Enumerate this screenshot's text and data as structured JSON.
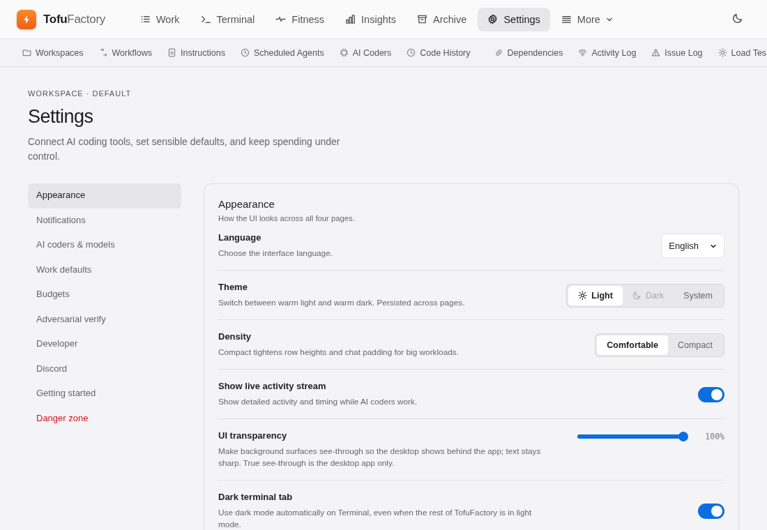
{
  "brand": {
    "name": "**Tofu**Factory"
  },
  "nav": [
    {
      "label": "Work",
      "selected": false
    },
    {
      "label": "Terminal",
      "selected": false
    },
    {
      "label": "Fitness",
      "selected": false
    },
    {
      "label": "Insights",
      "selected": false
    },
    {
      "label": "Archive",
      "selected": false
    },
    {
      "label": "Settings",
      "selected": true
    },
    {
      "label": "More",
      "selected": false
    }
  ],
  "subnav": [
    {
      "label": "Workspaces"
    },
    {
      "label": "Workflows"
    },
    {
      "label": "Instructions"
    },
    {
      "label": "Scheduled Agents"
    },
    {
      "label": "AI Coders"
    },
    {
      "label": "Code History"
    },
    {
      "label": "Dependencies"
    },
    {
      "label": "Activity Log"
    },
    {
      "label": "Issue Log"
    },
    {
      "label": "Load Tes"
    }
  ],
  "header": {
    "eyebrow": "WORKSPACE · DEFAULT",
    "title": "Settings",
    "subtitle": "Connect AI coding tools, set sensible defaults, and keep spending under control."
  },
  "sections": [
    {
      "label": "Appearance",
      "selected": true,
      "danger": false
    },
    {
      "label": "Notifications",
      "selected": false,
      "danger": false
    },
    {
      "label": "AI coders & models",
      "selected": false,
      "danger": false
    },
    {
      "label": "Work defaults",
      "selected": false,
      "danger": false
    },
    {
      "label": "Budgets",
      "selected": false,
      "danger": false
    },
    {
      "label": "Adversarial verify",
      "selected": false,
      "danger": false
    },
    {
      "label": "Developer",
      "selected": false,
      "danger": false
    },
    {
      "label": "Discord",
      "selected": false,
      "danger": false
    },
    {
      "label": "Getting started",
      "selected": false,
      "danger": false
    },
    {
      "label": "Danger zone",
      "selected": false,
      "danger": true
    }
  ],
  "panel": {
    "title": "Appearance",
    "subtitle": "How the UI looks across all four pages.",
    "rows": [
      {
        "kind": "select",
        "label": "Language",
        "description": "Choose the interface language.",
        "value": "English"
      },
      {
        "kind": "segmented",
        "label": "Theme",
        "description": "Switch between warm light and warm dark. Persisted across pages.",
        "options": [
          {
            "label": "Light",
            "selected": true,
            "disabled": false
          },
          {
            "label": "Dark",
            "selected": false,
            "disabled": true
          },
          {
            "label": "System",
            "selected": false,
            "disabled": false
          }
        ]
      },
      {
        "kind": "segmented",
        "label": "Density",
        "description": "Compact tightens row heights and chat padding for big workloads.",
        "options": [
          {
            "label": "Comfortable",
            "selected": true,
            "disabled": false
          },
          {
            "label": "Compact",
            "selected": false,
            "disabled": false
          }
        ]
      },
      {
        "kind": "toggle",
        "label": "Show live activity stream",
        "description": "Show detailed activity and timing while AI coders work.",
        "on": true
      },
      {
        "kind": "slider",
        "label": "UI transparency",
        "description": "Make background surfaces see-through so the desktop shows behind the app; text stays sharp. True see-through is the desktop app only.",
        "level": 1,
        "reading": "100%"
      },
      {
        "kind": "toggle",
        "label": "Dark terminal tab",
        "description": "Use dark mode automatically on Terminal, even when the rest of TofuFactory is in light mode.",
        "on": true
      }
    ]
  }
}
